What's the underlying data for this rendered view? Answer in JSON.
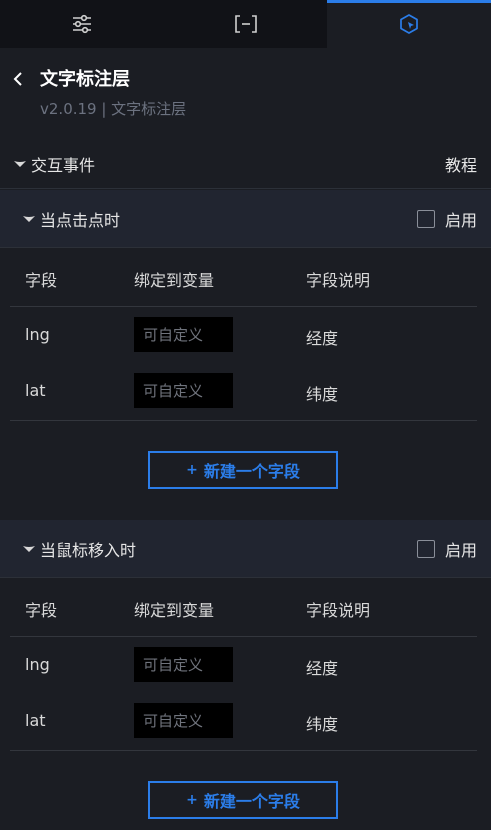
{
  "tabs": [
    {
      "icon": "sliders-icon",
      "active": false
    },
    {
      "icon": "bracket-minus-icon",
      "active": false
    },
    {
      "icon": "interaction-icon",
      "active": true
    }
  ],
  "header": {
    "title": "文字标注层",
    "subtitle": "v2.0.19 | 文字标注层"
  },
  "interaction": {
    "label": "交互事件",
    "tutorial": "教程"
  },
  "events": [
    {
      "label": "当点击点时",
      "enable_label": "启用",
      "enabled": false,
      "columns": [
        "字段",
        "绑定到变量",
        "字段说明"
      ],
      "rows": [
        {
          "field": "lng",
          "placeholder": "可自定义",
          "desc": "经度"
        },
        {
          "field": "lat",
          "placeholder": "可自定义",
          "desc": "纬度"
        }
      ],
      "add_label": "新建一个字段"
    },
    {
      "label": "当鼠标移入时",
      "enable_label": "启用",
      "enabled": false,
      "columns": [
        "字段",
        "绑定到变量",
        "字段说明"
      ],
      "rows": [
        {
          "field": "lng",
          "placeholder": "可自定义",
          "desc": "经度"
        },
        {
          "field": "lat",
          "placeholder": "可自定义",
          "desc": "纬度"
        }
      ],
      "add_label": "新建一个字段"
    }
  ],
  "colors": {
    "accent": "#2b7de9",
    "background": "#1b1d23",
    "tab_bar": "#111217",
    "event_header": "#212530"
  }
}
